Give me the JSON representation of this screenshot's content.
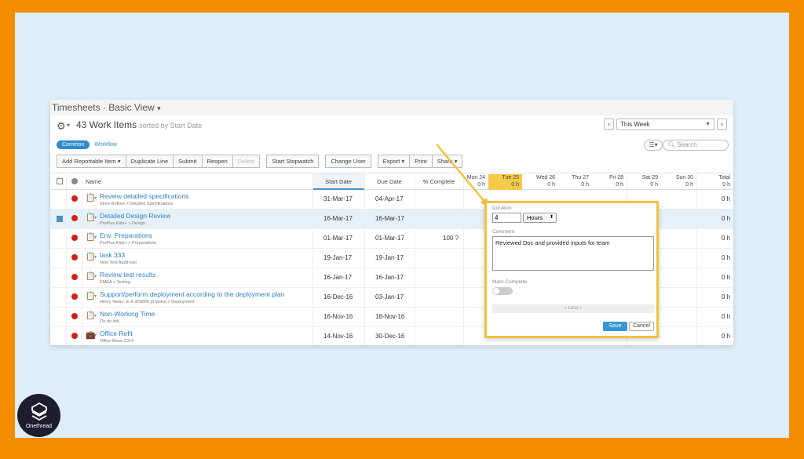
{
  "app": {
    "title": "Timesheets · Basic View",
    "title_caret": "▾",
    "work_items_title": "43 Work Items",
    "sorted_text": "sorted by Start Date"
  },
  "week_nav": {
    "prev": "‹",
    "period": "This Week",
    "next": "›"
  },
  "tabs": {
    "active": "Common",
    "other": "Workflow"
  },
  "search": {
    "placeholder": "Search"
  },
  "toolbar": {
    "add_reportable": "Add Reportable Item ▾",
    "duplicate_line": "Duplicate Line",
    "submit": "Submit",
    "reopen": "Reopen",
    "delete": "Delete",
    "start_stopwatch": "Start Stopwatch",
    "change_user": "Change User",
    "export": "Export ▾",
    "print": "Print",
    "share": "Share ▾"
  },
  "columns": {
    "name": "Name",
    "start_date": "Start Date",
    "due_date": "Due Date",
    "pct_complete": "% Complete",
    "days": [
      {
        "day": "Mon 24",
        "hours": "0 h"
      },
      {
        "day": "Tue 25",
        "hours": "0 h"
      },
      {
        "day": "Wed 26",
        "hours": "0 h"
      },
      {
        "day": "Thu 27",
        "hours": "0 h"
      },
      {
        "day": "Fri 28",
        "hours": "0 h"
      },
      {
        "day": "Sat 29",
        "hours": "0 h"
      },
      {
        "day": "Sun 30",
        "hours": "0 h"
      }
    ],
    "total": {
      "day": "Total",
      "hours": "0 h"
    }
  },
  "rows": [
    {
      "icon": "📋",
      "name": "Review detailed specifications",
      "sub": "Store Rollout > Detailed Specifications",
      "start": "31-Mar-17",
      "due": "04-Apr-17",
      "pct": "",
      "total": "0 h"
    },
    {
      "icon": "📋",
      "name": "Detailed Design Review",
      "sub": "ProPlus Kids+ > Design",
      "start": "16-Mar-17",
      "due": "16-Mar-17",
      "pct": "",
      "total": "0 h"
    },
    {
      "icon": "📋",
      "name": "Env. Preparations",
      "sub": "ProPlus Kids+ > Preparations",
      "start": "01-Mar-17",
      "due": "01-Mar-17",
      "pct": "100 ?",
      "total": "0 h"
    },
    {
      "icon": "📋",
      "name": "task 333",
      "sub": "New Test Audit trail",
      "start": "19-Jan-17",
      "due": "19-Jan-17",
      "pct": "",
      "total": "0 h"
    },
    {
      "icon": "📋",
      "name": "Review test results",
      "sub": "EMEA > Testing",
      "start": "16-Jan-17",
      "due": "16-Jan-17",
      "pct": "",
      "total": "0 h"
    },
    {
      "icon": "📋",
      "name": "Support/perform deployment according to the deployment plan",
      "sub": "Henry Nelau: E-X-309805 [3 tasks] > Deployment",
      "start": "16-Dec-16",
      "due": "03-Jan-17",
      "pct": "",
      "total": "0 h"
    },
    {
      "icon": "📋",
      "name": "Non-Working Time",
      "sub": "[To do list]",
      "start": "16-Nov-16",
      "due": "18-Nov-16",
      "pct": "",
      "total": "0 h"
    },
    {
      "icon": "💼",
      "name": "Office Refit",
      "sub": "Office Move 2014",
      "start": "14-Nov-16",
      "due": "30-Dec-16",
      "pct": "",
      "total": "0 h"
    }
  ],
  "popup": {
    "duration_label": "Duration",
    "duration_value": "4",
    "unit": "Hours",
    "comment_label": "Comment",
    "comment_value": "Reviewed Doc and provided inputs for team",
    "mark_complete_label": "Mark Complete",
    "less": "« Less «",
    "save": "Save",
    "cancel": "Cancel"
  },
  "brand": {
    "name": "Onethread"
  },
  "colors": {
    "frame": "#f28c00",
    "inner": "#dfeef8",
    "accent": "#2f8ccd",
    "highlight": "#f2c23b"
  }
}
